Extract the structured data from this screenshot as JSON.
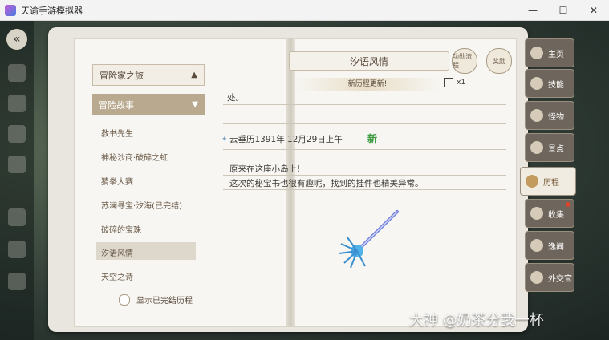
{
  "window": {
    "title": "天谕手游模拟器",
    "controls": [
      "—",
      "☐",
      "✕"
    ]
  },
  "sidebar": {
    "sections": [
      {
        "label": "冒险家之旅"
      },
      {
        "label": "冒险故事"
      }
    ],
    "stories": [
      "教书先生",
      "神秘沙商·破碎之虹",
      "猜拳大赛",
      "苏澜寻宝·汐海(已完结)",
      "破碎的宝珠",
      "汐语风情",
      "天空之诗"
    ],
    "toggle_label": "显示已完结历程"
  },
  "page": {
    "title": "汐语风情",
    "badge1": "功勋流程",
    "badge2": "奖励",
    "update_text": "新历程更新!",
    "count": "x1",
    "prev_text": "处。",
    "date_text": "云垂历1391年   12月29日上午",
    "new_tag": "新",
    "line1": "原来在这座小岛上!",
    "line2": "这次的秘宝书也很有趣呢，找到的挂件也精美异常。"
  },
  "right_nav": [
    "主页",
    "技能",
    "怪物",
    "景点",
    "历程",
    "收集",
    "逸闻",
    "外交官"
  ],
  "watermark": "大神 @奶茶分我一杯",
  "colors": {
    "accent": "#b8a98f",
    "new": "#3d9a41"
  }
}
